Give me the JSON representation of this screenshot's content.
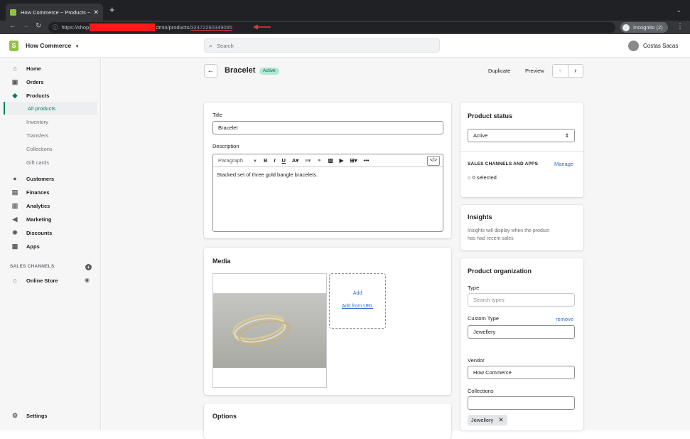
{
  "browser": {
    "tab_title": "How Commerce ~ Products ~ B",
    "new_tab": "+",
    "url_prefix": "https://shop",
    "url_mid": "dmin/products/",
    "url_id": "32472260349095",
    "incognito": "Incognito (2)"
  },
  "topbar": {
    "store_name": "How Commerce",
    "search_placeholder": "Search",
    "user_name": "Costas Sacas"
  },
  "sidebar": {
    "items": [
      {
        "label": "Home"
      },
      {
        "label": "Orders"
      },
      {
        "label": "Products"
      },
      {
        "label": "Customers"
      },
      {
        "label": "Finances"
      },
      {
        "label": "Analytics"
      },
      {
        "label": "Marketing"
      },
      {
        "label": "Discounts"
      },
      {
        "label": "Apps"
      }
    ],
    "product_subitems": [
      "All products",
      "Inventory",
      "Transfers",
      "Collections",
      "Gift cards"
    ],
    "sales_channels_label": "SALES CHANNELS",
    "online_store": "Online Store",
    "settings": "Settings"
  },
  "page": {
    "title": "Bracelet",
    "status_badge": "Active",
    "duplicate": "Duplicate",
    "preview": "Preview"
  },
  "product_form": {
    "title_label": "Title",
    "title_value": "Bracelet",
    "description_label": "Description",
    "paragraph_select": "Paragraph",
    "description_text": "Stacked set of three gold bangle bracelets."
  },
  "media": {
    "heading": "Media",
    "add": "Add",
    "add_from_url": "Add from URL"
  },
  "options": {
    "heading": "Options"
  },
  "product_status": {
    "heading": "Product status",
    "selected": "Active",
    "channels_label": "SALES CHANNELS AND APPS",
    "manage": "Manage",
    "selected_count": "0 selected"
  },
  "insights": {
    "heading": "Insights",
    "text_line1": "Insights will display when the product",
    "text_line2": "has had recent sales"
  },
  "organization": {
    "heading": "Product organization",
    "type_label": "Type",
    "type_placeholder": "Search types",
    "custom_type_label": "Custom Type",
    "remove": "remove",
    "custom_type_value": "Jewellery",
    "vendor_label": "Vendor",
    "vendor_value": "How Commerce",
    "collections_label": "Collections",
    "collection_tag": "Jewellery"
  },
  "colors": {
    "accent_green": "#008060",
    "link_blue": "#2c6ecb",
    "redaction": "#ff1a1a"
  }
}
